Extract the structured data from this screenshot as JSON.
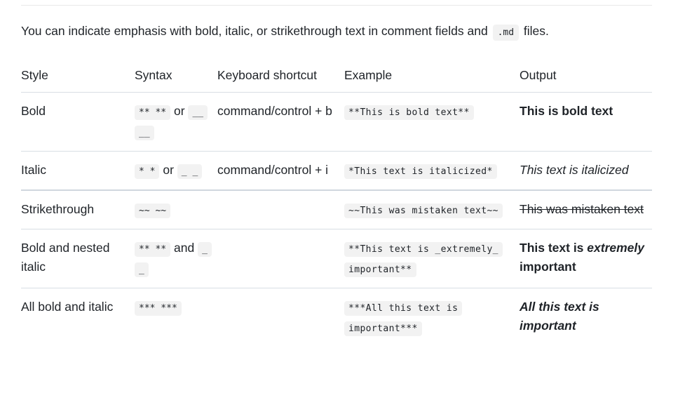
{
  "intro": {
    "before": "You can indicate emphasis with bold, italic, or strikethrough text in comment fields and",
    "code": ".md",
    "after": "files."
  },
  "table": {
    "headers": [
      "Style",
      "Syntax",
      "Keyboard shortcut",
      "Example",
      "Output"
    ],
    "rows": [
      {
        "style": "Bold",
        "syntax_a": "** **",
        "syntax_join": "or",
        "syntax_b": "__ __",
        "shortcut": "command/control + b",
        "example": "**This is bold text**",
        "output": "This is bold text"
      },
      {
        "style": "Italic",
        "syntax_a": "* *",
        "syntax_join": "or",
        "syntax_b": "_ _",
        "shortcut": "command/control + i",
        "example": "*This text is italicized*",
        "output": "This text is italicized"
      },
      {
        "style": "Strikethrough",
        "syntax_a": "~~ ~~",
        "shortcut": "",
        "example": "~~This was mistaken text~~",
        "output": "This was mistaken text"
      },
      {
        "style": "Bold and nested italic",
        "syntax_a": "** **",
        "syntax_join": "and",
        "syntax_b": "_ _",
        "shortcut": "",
        "example": "**This text is _extremely_ important**",
        "output_pre": "This text is ",
        "output_em": "extremely",
        "output_post": " important"
      },
      {
        "style": "All bold and italic",
        "syntax_a": "*** ***",
        "shortcut": "",
        "example": "***All this text is important***",
        "output": "All this text is important"
      }
    ]
  }
}
